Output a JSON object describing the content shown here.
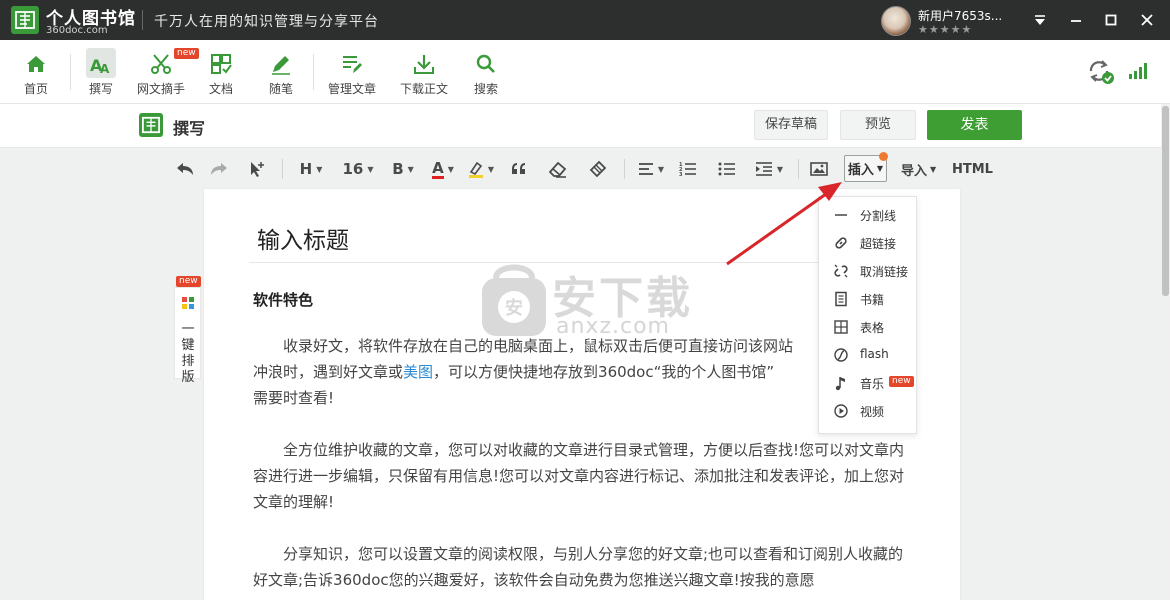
{
  "titlebar": {
    "app_name": "个人图书馆",
    "app_domain": "360doc.com",
    "slogan": "千万人在用的知识管理与分享平台",
    "username": "新用户7653s...",
    "stars": "★★★★★"
  },
  "main_toolbar": {
    "items": [
      {
        "label": "首页",
        "icon": "home-icon"
      },
      {
        "label": "撰写",
        "icon": "write-icon",
        "active": true
      },
      {
        "label": "网文摘手",
        "icon": "scissors-icon",
        "badge": "new"
      },
      {
        "label": "文档",
        "icon": "document-icon"
      },
      {
        "label": "随笔",
        "icon": "pen-icon"
      },
      {
        "label": "管理文章",
        "icon": "manage-icon"
      },
      {
        "label": "下载正文",
        "icon": "download-icon"
      },
      {
        "label": "搜索",
        "icon": "search-icon"
      }
    ]
  },
  "compose": {
    "title": "撰写",
    "save_draft": "保存草稿",
    "preview": "预览",
    "publish": "发表"
  },
  "format_toolbar": {
    "heading": "H",
    "font_size": "16",
    "bold": "B",
    "font_color": "A",
    "insert_label": "插入",
    "import_label": "导入",
    "html_label": "HTML"
  },
  "editor": {
    "title_placeholder": "输入标题",
    "subtitle": "软件特色",
    "para1_line1_a": "收录好文，将软件存放在自己的电脑桌面上，鼠标双击后便可直接访问该网站",
    "para1_line2_a": "冲浪时，遇到好文章或",
    "para1_link": "美图",
    "para1_line2_b": "，可以方便快捷地存放到360doc“我的个人图书馆”",
    "para1_line3": "需要时查看!",
    "para2": "全方位维护收藏的文章，您可以对收藏的文章进行目录式管理，方便以后查找!您可以对文章内容进行进一步编辑，只保留有用信息!您可以对文章内容进行标记、添加批注和发表评论，加上您对文章的理解!",
    "para3": "分享知识，您可以设置文章的阅读权限，与别人分享您的好文章;也可以查看和订阅别人收藏的好文章;告诉360doc您的兴趣爱好，该软件会自动免费为您推送兴趣文章!按我的意愿"
  },
  "side_panel": {
    "badge": "new",
    "label": "一键排版"
  },
  "insert_menu": {
    "items": [
      {
        "label": "分割线",
        "icon": "divider-icon"
      },
      {
        "label": "超链接",
        "icon": "link-icon"
      },
      {
        "label": "取消链接",
        "icon": "unlink-icon"
      },
      {
        "label": "书籍",
        "icon": "book-icon"
      },
      {
        "label": "表格",
        "icon": "table-icon"
      },
      {
        "label": "flash",
        "icon": "flash-icon"
      },
      {
        "label": "音乐",
        "icon": "music-icon",
        "badge": "new"
      },
      {
        "label": "视频",
        "icon": "video-icon"
      }
    ]
  },
  "watermark": {
    "text": "安下载",
    "sub": "anxz.com"
  },
  "colors": {
    "accent_green": "#3e9e33",
    "titlebar": "#2d2f2e",
    "badge_red": "#e4462b",
    "arrow_red": "#d9262a"
  }
}
